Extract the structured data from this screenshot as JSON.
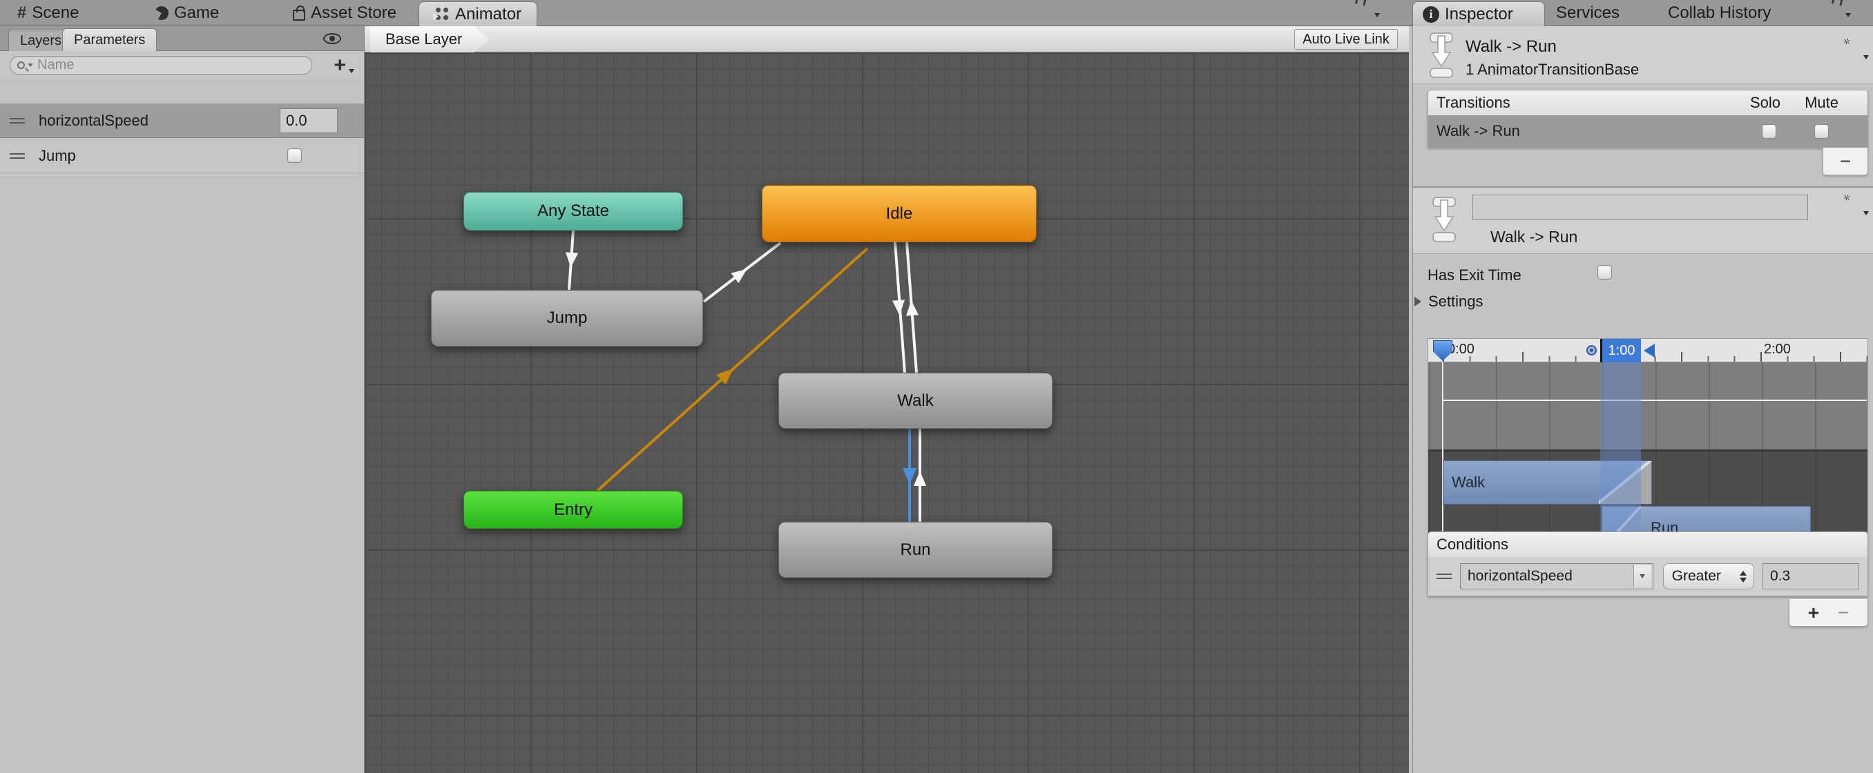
{
  "window": {
    "tabs": [
      {
        "label": "Scene"
      },
      {
        "label": "Game"
      },
      {
        "label": "Asset Store"
      },
      {
        "label": "Animator"
      }
    ]
  },
  "parameters_panel": {
    "tabs": {
      "layers": "Layers",
      "parameters": "Parameters"
    },
    "active_tab": "Parameters",
    "search": {
      "placeholder": "Name"
    },
    "add_button": "+",
    "rows": [
      {
        "name": "horizontalSpeed",
        "type": "float",
        "value": "0.0",
        "selected": true
      },
      {
        "name": "Jump",
        "type": "bool",
        "checked": false
      }
    ]
  },
  "graph": {
    "breadcrumb": "Base Layer",
    "auto_live_link": "Auto Live Link",
    "nodes": [
      {
        "label": "Any State",
        "color": "#5FC0A8"
      },
      {
        "label": "Idle",
        "color": "#F79810"
      },
      {
        "label": "Jump",
        "color": "#A8A8A8"
      },
      {
        "label": "Walk",
        "color": "#A8A8A8"
      },
      {
        "label": "Entry",
        "color": "#36CC1C"
      },
      {
        "label": "Run",
        "color": "#A8A8A8"
      }
    ],
    "transitions": [
      {
        "from": "Any State",
        "to": "Jump",
        "color": "#FFFFFF"
      },
      {
        "from": "Jump",
        "to": "Idle",
        "color": "#FFFFFF"
      },
      {
        "from": "Idle",
        "to": "Walk",
        "color": "#FFFFFF"
      },
      {
        "from": "Walk",
        "to": "Idle",
        "color": "#FFFFFF"
      },
      {
        "from": "Walk",
        "to": "Run",
        "color": "#4A90E2",
        "selected": true
      },
      {
        "from": "Run",
        "to": "Walk",
        "color": "#FFFFFF"
      },
      {
        "from": "Entry",
        "to": "Idle",
        "color": "#C8860A"
      }
    ]
  },
  "inspector": {
    "tabs": [
      {
        "label": "Inspector"
      },
      {
        "label": "Services"
      },
      {
        "label": "Collab History"
      }
    ],
    "header": {
      "title": "Walk -> Run",
      "subtitle": "1 AnimatorTransitionBase"
    },
    "transitions_section": {
      "title": "Transitions",
      "solo_label": "Solo",
      "mute_label": "Mute",
      "rows": [
        {
          "label": "Walk -> Run",
          "solo": false,
          "mute": false,
          "selected": true
        }
      ],
      "remove_button": "−"
    },
    "name_block": {
      "field_value": "",
      "label": "Walk -> Run"
    },
    "has_exit_time": {
      "label": "Has Exit Time",
      "checked": false
    },
    "settings_label": "Settings",
    "timeline": {
      "ruler_labels": [
        "0:00",
        "1:00",
        "2:00"
      ],
      "selected_time": "1:00",
      "tracks": [
        {
          "label": "Walk"
        },
        {
          "label": "Run"
        }
      ]
    },
    "conditions": {
      "title": "Conditions",
      "rows": [
        {
          "param": "horizontalSpeed",
          "op": "Greater",
          "value": "0.3"
        }
      ],
      "add_button": "+",
      "remove_button": "−"
    }
  },
  "colors": {
    "accent_blue": "#3D7CD6",
    "node_teal": "#5FC0A8",
    "node_orange": "#F79810",
    "node_green": "#36CC1C",
    "transition_orange": "#C8860A",
    "graph_background": "#575757",
    "panel_background": "#C3C3C3"
  }
}
